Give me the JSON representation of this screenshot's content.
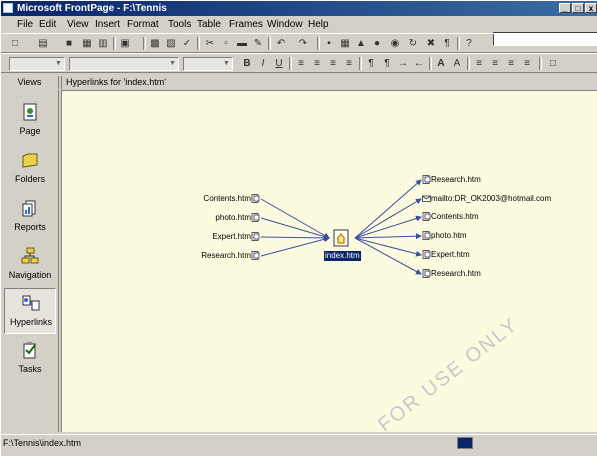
{
  "window": {
    "title": "Microsoft FrontPage - F:\\Tennis",
    "controls": {
      "minimize": "_",
      "maximize": "□",
      "close": "x"
    }
  },
  "menubar": {
    "items": [
      "File",
      "Edit",
      "View",
      "Insert",
      "Format",
      "Tools",
      "Table",
      "Frames",
      "Window",
      "Help"
    ]
  },
  "views": {
    "header": "Views",
    "items": [
      {
        "label": "Page",
        "icon": "page-icon"
      },
      {
        "label": "Folders",
        "icon": "folders-icon"
      },
      {
        "label": "Reports",
        "icon": "reports-icon"
      },
      {
        "label": "Navigation",
        "icon": "navigation-icon"
      },
      {
        "label": "Hyperlinks",
        "icon": "hyperlinks-icon",
        "selected": true
      },
      {
        "label": "Tasks",
        "icon": "tasks-icon"
      }
    ]
  },
  "pane": {
    "header": "Hyperlinks for 'index.htm'"
  },
  "diagram": {
    "center": "index.htm",
    "incoming": [
      "Contents.htm",
      "photo.htm",
      "Expert.htm",
      "Research.htm"
    ],
    "outgoing": [
      {
        "label": "Research.htm",
        "type": "page"
      },
      {
        "label": "mailto:DR_OK2003@hotmail.com",
        "type": "mail"
      },
      {
        "label": "Contents.htm",
        "type": "page"
      },
      {
        "label": "photo.htm",
        "type": "page"
      },
      {
        "label": "Expert.htm",
        "type": "page"
      },
      {
        "label": "Research.htm",
        "type": "page"
      }
    ]
  },
  "watermark": "FOR USE ONLY",
  "statusbar": {
    "path": "F:\\Tennis\\index.htm"
  },
  "colors": {
    "titlebar": "#0a246a",
    "content_bg": "#fdfbdf",
    "chrome": "#d4d0c8",
    "link_line": "#3a4ea0"
  }
}
